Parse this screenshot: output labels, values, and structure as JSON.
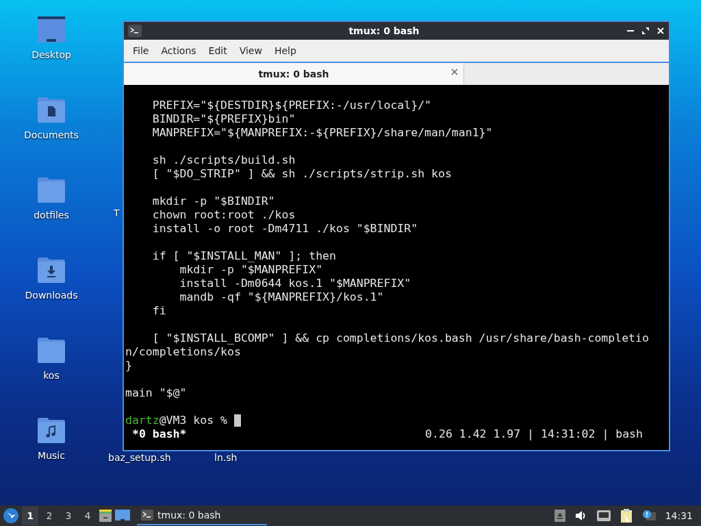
{
  "desktop": {
    "icons": [
      {
        "label": "Desktop",
        "kind": "desktop"
      },
      {
        "label": "Documents",
        "kind": "documents"
      },
      {
        "label": "dotfiles",
        "kind": "plain"
      },
      {
        "label": "Downloads",
        "kind": "downloads"
      },
      {
        "label": "kos",
        "kind": "plain"
      },
      {
        "label": "Music",
        "kind": "music"
      }
    ],
    "partial_labels": [
      "T",
      "baz_setup.sh",
      "ln.sh"
    ]
  },
  "window": {
    "title": "tmux: 0 bash",
    "menu": [
      "File",
      "Actions",
      "Edit",
      "View",
      "Help"
    ],
    "tabs": [
      {
        "label": "tmux: 0 bash",
        "selected": true
      }
    ],
    "terminal": {
      "blocks": [
        [
          "    PREFIX=\"${DESTDIR}${PREFIX:-/usr/local}/\"",
          "    BINDIR=\"${PREFIX}bin\"",
          "    MANPREFIX=\"${MANPREFIX:-${PREFIX}/share/man/man1}\""
        ],
        [
          "    sh ./scripts/build.sh",
          "    [ \"$DO_STRIP\" ] && sh ./scripts/strip.sh kos"
        ],
        [
          "    mkdir -p \"$BINDIR\"",
          "    chown root:root ./kos",
          "    install -o root -Dm4711 ./kos \"$BINDIR\""
        ],
        [
          "    if [ \"$INSTALL_MAN\" ]; then",
          "        mkdir -p \"$MANPREFIX\"",
          "        install -Dm0644 kos.1 \"$MANPREFIX\"",
          "        mandb -qf \"${MANPREFIX}/kos.1\"",
          "    fi"
        ],
        [
          "    [ \"$INSTALL_BCOMP\" ] && cp completions/kos.bash /usr/share/bash-completio",
          "n/completions/kos",
          "}"
        ],
        [
          "main \"$@\""
        ]
      ],
      "prompt": {
        "user": "dartz",
        "rest": "@VM3 kos % "
      },
      "status_left": "*0 bash*",
      "status_right": "0.26 1.42 1.97 | 14:31:02 | bash"
    }
  },
  "taskbar": {
    "workspaces": [
      {
        "label": "1",
        "selected": true
      },
      {
        "label": "2",
        "selected": false
      },
      {
        "label": "3",
        "selected": false
      },
      {
        "label": "4",
        "selected": false
      }
    ],
    "tasks": [
      {
        "label": "tmux: 0 bash",
        "selected": true
      }
    ],
    "clock": "14:31"
  }
}
